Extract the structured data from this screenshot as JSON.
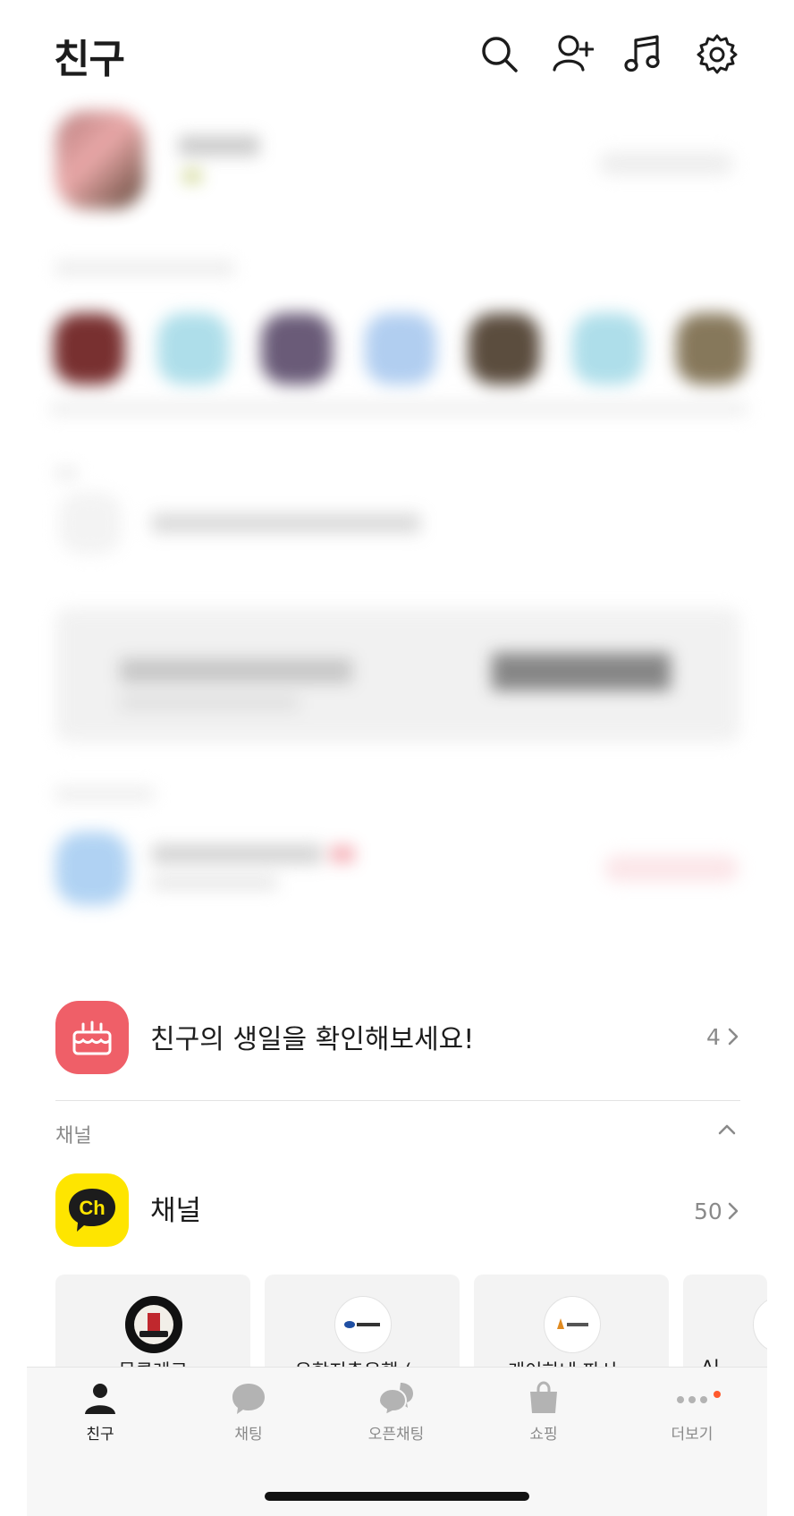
{
  "header": {
    "title": "친구",
    "icons": [
      "search-icon",
      "add-friend-icon",
      "music-icon",
      "settings-icon"
    ]
  },
  "birthday": {
    "text": "친구의 생일을 확인해보세요!",
    "count": "4",
    "icon": "cake-icon",
    "color": "#ef5f68"
  },
  "channel_section": {
    "label": "채널",
    "channel": {
      "label": "채널",
      "count": "50",
      "icon_text": "Ch",
      "color": "#fee500"
    },
    "cards": [
      {
        "name": "몽클레르"
      },
      {
        "name": "우함지축은행 (..."
      },
      {
        "name": "케이하네 파시..."
      },
      {
        "name": "Al..."
      }
    ]
  },
  "tabbar": {
    "items": [
      {
        "label": "친구",
        "icon": "person-icon",
        "active": true
      },
      {
        "label": "채팅",
        "icon": "chat-bubble-icon",
        "active": false
      },
      {
        "label": "오픈채팅",
        "icon": "open-chat-icon",
        "active": false
      },
      {
        "label": "쇼핑",
        "icon": "shopping-bag-icon",
        "active": false
      },
      {
        "label": "더보기",
        "icon": "more-icon",
        "active": false,
        "badge": true
      }
    ]
  }
}
